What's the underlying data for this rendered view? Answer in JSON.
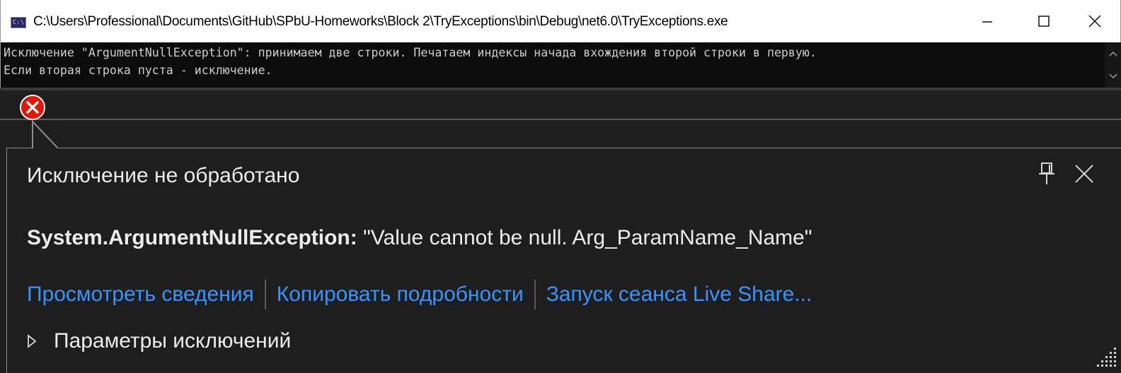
{
  "window": {
    "icon": "console-app-icon",
    "icon_text": "C:\\",
    "title": "C:\\Users\\Professional\\Documents\\GitHub\\SPbU-Homeworks\\Block 2\\TryExceptions\\bin\\Debug\\net6.0\\TryExceptions.exe",
    "controls": {
      "minimize": "minimize-icon",
      "maximize": "maximize-icon",
      "close": "close-icon"
    }
  },
  "console": {
    "lines": [
      "Исключение \"ArgumentNullException\": принимаем две строки. Печатаем индексы начада вхождения второй строки в первую.",
      "Если вторая строка пуста - исключение."
    ]
  },
  "exception_helper": {
    "glyph": "error-circle-icon",
    "title": "Исключение не обработано",
    "exception_type": "System.ArgumentNullException:",
    "exception_message": " \"Value cannot be null. Arg_ParamName_Name\"",
    "links": [
      "Просмотреть сведения",
      "Копировать подробности",
      "Запуск сеанса Live Share..."
    ],
    "parameters_label": "Параметры исключений",
    "pin": "pin-icon",
    "close": "close-icon"
  },
  "colors": {
    "console_bg": "#0c0c0c",
    "panel_bg": "#1e1e1e",
    "link": "#3794ff",
    "error": "#e51400"
  }
}
